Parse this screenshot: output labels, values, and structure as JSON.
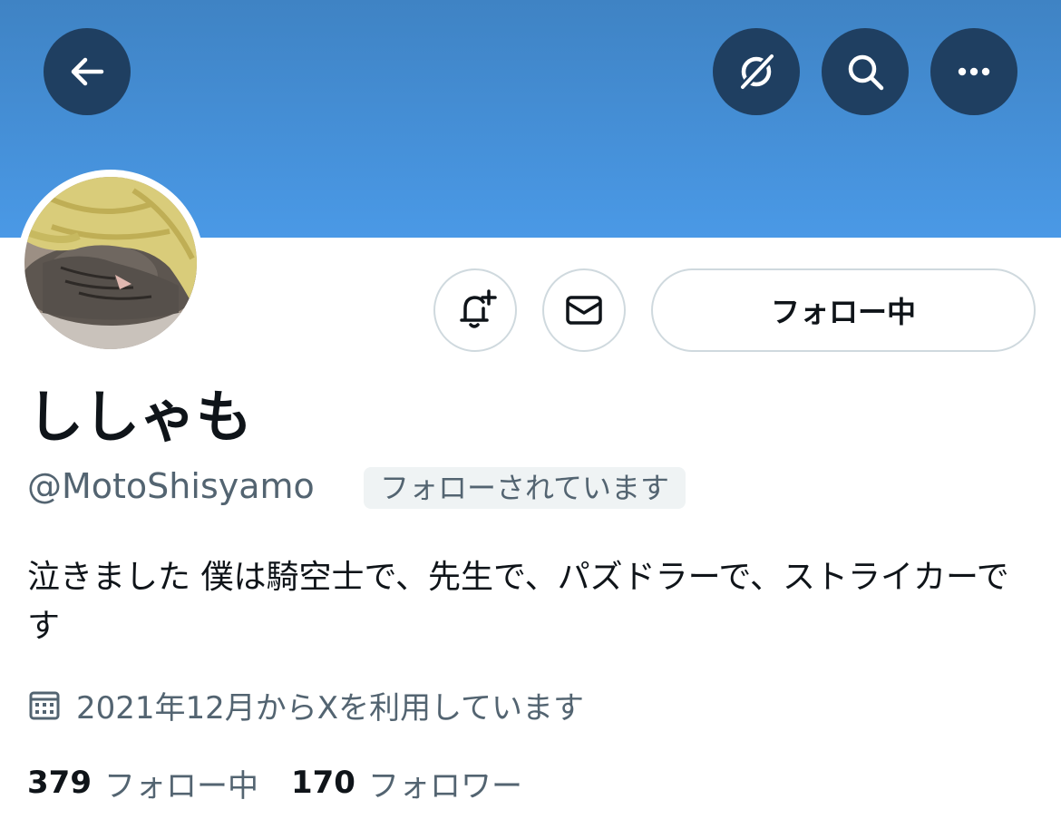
{
  "header": {
    "back_icon": "arrow-left-icon",
    "grok_icon": "slashed-circle-icon",
    "search_icon": "search-icon",
    "more_icon": "more-horizontal-icon",
    "banner_color": "#4a99e6",
    "button_color": "#1f3f61"
  },
  "profile": {
    "display_name": "ししゃも",
    "handle": "@MotoShisyamo",
    "follows_you_badge": "フォローされています",
    "bio": "泣きました 僕は騎空士で、先生で、パズドラーで、ストライカーです",
    "joined": "2021年12月からXを利用しています",
    "joined_icon": "calendar-icon"
  },
  "actions": {
    "notify_icon": "bell-plus-icon",
    "message_icon": "mail-icon",
    "following_label": "フォロー中"
  },
  "stats": {
    "following_count": "379",
    "following_label": "フォロー中",
    "followers_count": "170",
    "followers_label": "フォロワー"
  }
}
